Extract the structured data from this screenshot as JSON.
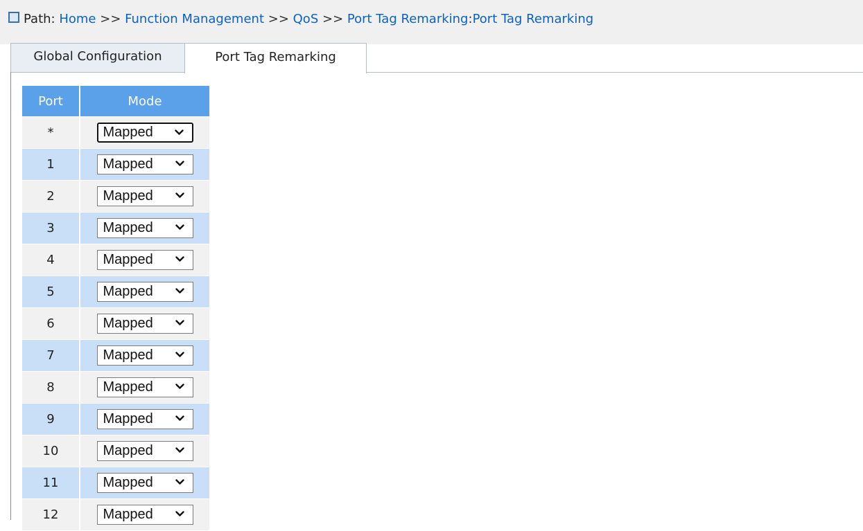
{
  "breadcrumb": {
    "label": "Path:",
    "sep": ">>",
    "items": [
      "Home",
      "Function Management",
      "QoS",
      "Port Tag Remarking"
    ],
    "colon": ":",
    "current": "Port Tag Remarking"
  },
  "tabs": [
    {
      "label": "Global Configuration",
      "active": false
    },
    {
      "label": "Port Tag Remarking",
      "active": true
    }
  ],
  "table": {
    "headers": {
      "port": "Port",
      "mode": "Mode"
    },
    "rows": [
      {
        "port": "*",
        "mode": "Mapped"
      },
      {
        "port": "1",
        "mode": "Mapped"
      },
      {
        "port": "2",
        "mode": "Mapped"
      },
      {
        "port": "3",
        "mode": "Mapped"
      },
      {
        "port": "4",
        "mode": "Mapped"
      },
      {
        "port": "5",
        "mode": "Mapped"
      },
      {
        "port": "6",
        "mode": "Mapped"
      },
      {
        "port": "7",
        "mode": "Mapped"
      },
      {
        "port": "8",
        "mode": "Mapped"
      },
      {
        "port": "9",
        "mode": "Mapped"
      },
      {
        "port": "10",
        "mode": "Mapped"
      },
      {
        "port": "11",
        "mode": "Mapped"
      },
      {
        "port": "12",
        "mode": "Mapped"
      }
    ]
  },
  "colors": {
    "header_bg": "#5aa1ea",
    "row_alt_bg": "#c8dff7",
    "row_bg": "#f1f1f1",
    "link": "#0b61c4"
  },
  "icons": {
    "path": "square-icon",
    "dropdown": "chevron-down-icon"
  }
}
